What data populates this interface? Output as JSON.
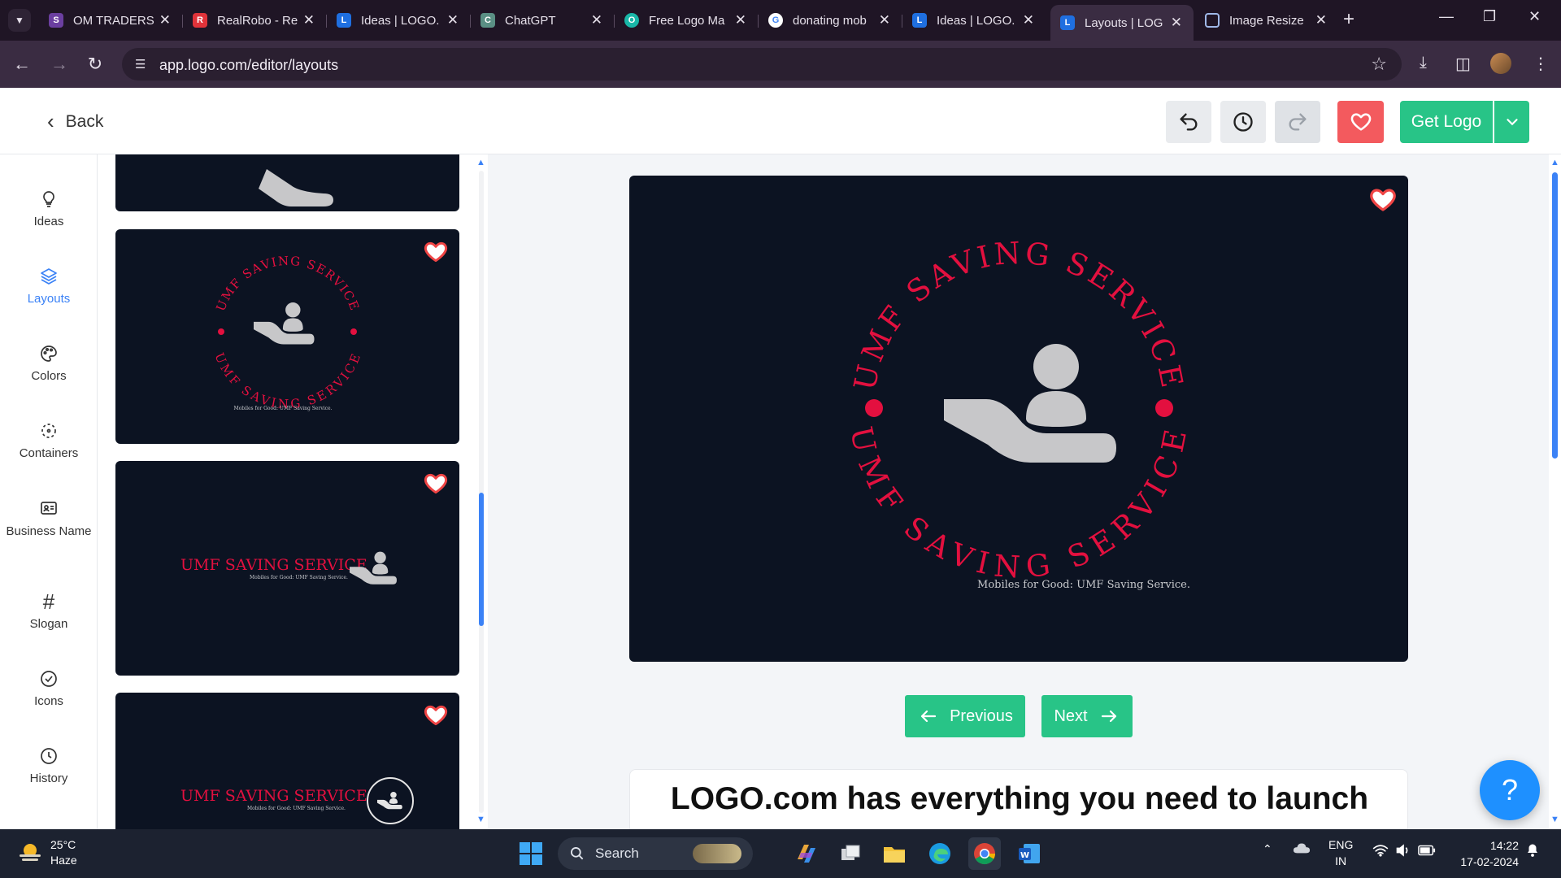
{
  "browser": {
    "tabs": [
      {
        "label": "OM TRADERS",
        "fav_color": "#6b3fa0",
        "fav": "S"
      },
      {
        "label": "RealRobo - Re",
        "fav_color": "#e0333a",
        "fav": "R"
      },
      {
        "label": "Ideas | LOGO.",
        "fav_color": "#1f6fe0",
        "fav": "L"
      },
      {
        "label": "ChatGPT",
        "fav_color": "#5a8f84",
        "fav": "C"
      },
      {
        "label": "Free Logo Ma",
        "fav_color": "#19b7a8",
        "fav": "O"
      },
      {
        "label": "donating mob",
        "fav_color": "#ffffff",
        "fav": "G"
      },
      {
        "label": "Ideas | LOGO.",
        "fav_color": "#1f6fe0",
        "fav": "L"
      },
      {
        "label": "Layouts | LOG",
        "fav_color": "#1f6fe0",
        "fav": "L"
      },
      {
        "label": "Image Resize",
        "fav_color": "#3b6fd1",
        "fav": "I"
      }
    ],
    "url": "app.logo.com/editor/layouts"
  },
  "header": {
    "back_label": "Back",
    "get_logo_label": "Get Logo"
  },
  "rail": {
    "items": [
      {
        "label": "Ideas",
        "icon": "bulb-icon"
      },
      {
        "label": "Layouts",
        "icon": "layers-icon"
      },
      {
        "label": "Colors",
        "icon": "palette-icon"
      },
      {
        "label": "Containers",
        "icon": "container-icon"
      },
      {
        "label": "Business Name",
        "icon": "id-card-icon"
      },
      {
        "label": "Slogan",
        "icon": "hash-icon"
      },
      {
        "label": "Icons",
        "icon": "check-circle-icon"
      },
      {
        "label": "History",
        "icon": "clock-icon"
      }
    ],
    "active": "Layouts"
  },
  "layouts": {
    "card_business_name": "UMF SAVING SERVICE",
    "card_slogan": "Mobiles for Good: UMF Saving Service."
  },
  "preview": {
    "business_name": "UMF SAVING SERVICE",
    "slogan": "Mobiles for Good: UMF Saving Service.",
    "prev_label": "Previous",
    "next_label": "Next"
  },
  "promo": {
    "title": "LOGO.com has everything you need to launch"
  },
  "colors": {
    "accent_red": "#e3103f",
    "logo_bg": "#0c1322",
    "icon_gray": "#c7c7c9",
    "green": "#28c487",
    "blue": "#3b82f6"
  },
  "taskbar": {
    "temp": "25°C",
    "weather": "Haze",
    "search_placeholder": "Search",
    "lang1": "ENG",
    "lang2": "IN",
    "time": "14:22",
    "date": "17-02-2024"
  }
}
